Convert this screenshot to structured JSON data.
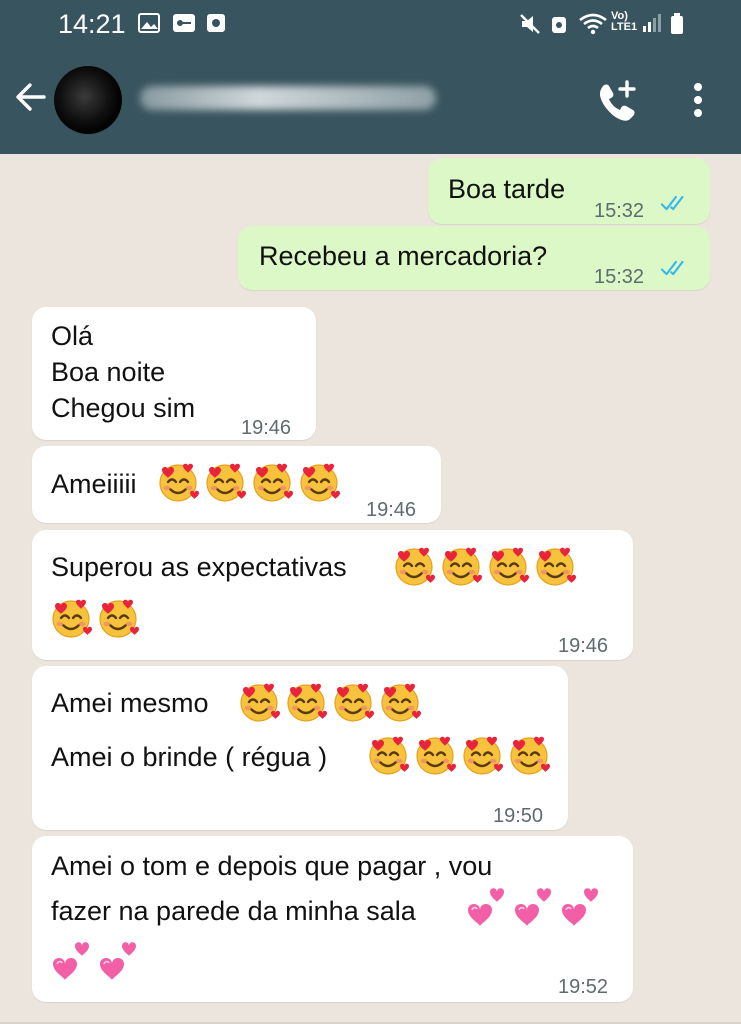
{
  "status_bar": {
    "time": "14:21",
    "network_label": "Vo) LTE1",
    "icons": [
      "image-icon",
      "key-icon",
      "app-icon",
      "mute-icon",
      "sync-icon",
      "wifi-icon",
      "signal-icon",
      "battery-icon"
    ]
  },
  "header": {
    "icons": [
      "back-arrow-icon",
      "avatar",
      "add-call-icon",
      "more-vert-icon"
    ],
    "colors": {
      "bar": "#38545e",
      "icon": "#ffffff"
    }
  },
  "messages": [
    {
      "direction": "out",
      "lines": [
        "Boa tarde"
      ],
      "time": "15:32",
      "read": true
    },
    {
      "direction": "out",
      "lines": [
        "Recebeu a mercadoria?"
      ],
      "time": "15:32",
      "read": true
    },
    {
      "direction": "in",
      "lines": [
        "Olá",
        "Boa noite",
        "Chegou sim"
      ],
      "time": "19:46"
    },
    {
      "direction": "in",
      "lines": [
        "Ameiiiii"
      ],
      "emoji": "smiling-face-with-hearts x4",
      "time": "19:46"
    },
    {
      "direction": "in",
      "lines": [
        "Superou as expectativas"
      ],
      "emoji": "smiling-face-with-hearts x6",
      "time": "19:46"
    },
    {
      "direction": "in",
      "lines": [
        "Amei mesmo",
        "Amei o brinde ( régua )"
      ],
      "emoji": "smiling-face-with-hearts x8",
      "time": "19:50"
    },
    {
      "direction": "in",
      "lines": [
        "Amei o tom e depois que pagar , vou",
        "fazer na parede da minha sala"
      ],
      "emoji": "two-hearts x5",
      "time": "19:52"
    }
  ],
  "colors": {
    "outgoing_bubble": "#dcf8c6",
    "incoming_bubble": "#ffffff",
    "chat_background": "#ece5dd",
    "read_ticks": "#34b7f1"
  }
}
